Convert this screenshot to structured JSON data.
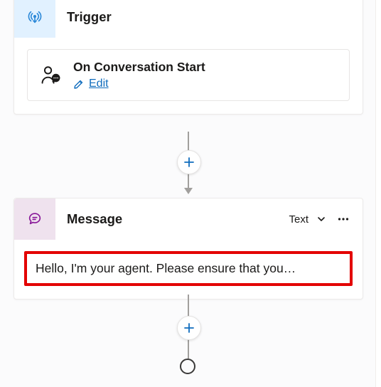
{
  "trigger_node": {
    "title": "Trigger",
    "event": {
      "title": "On Conversation Start",
      "edit_label": "Edit"
    }
  },
  "message_node": {
    "title": "Message",
    "output_type": "Text",
    "content": "Hello, I'm your agent. Please ensure that you…"
  },
  "icons": {
    "trigger": "antenna-icon",
    "event": "person-speech-icon",
    "edit": "pencil-icon",
    "message": "speech-bubble-icon",
    "chevron": "chevron-down-icon",
    "more": "more-icon",
    "add": "plus-icon"
  },
  "colors": {
    "trigger_tile": "#e1f1ff",
    "trigger_icon": "#2b88d8",
    "message_tile": "#efe2ee",
    "message_icon": "#881798",
    "link": "#0f6cbd",
    "highlight_border": "#e30000",
    "connector": "#a19f9d"
  }
}
